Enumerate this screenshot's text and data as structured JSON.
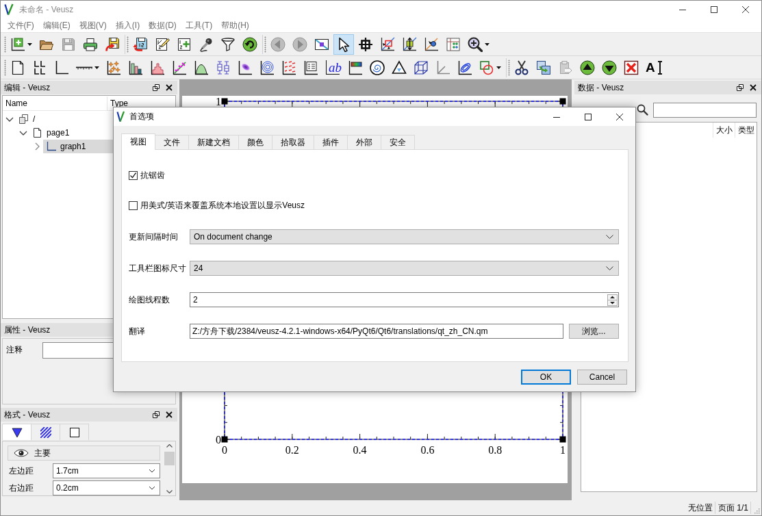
{
  "window": {
    "title": "未命名 - Veusz"
  },
  "menu": [
    "文件(F)",
    "编辑(E)",
    "视图(V)",
    "插入(I)",
    "数据(D)",
    "工具(T)",
    "帮助(H)"
  ],
  "toolbars": [
    [
      [
        {
          "disabled": false,
          "selected": false
        },
        {
          "disabled": false,
          "selected": false
        },
        {
          "disabled": true,
          "selected": false
        },
        {
          "disabled": false,
          "selected": false
        },
        {
          "disabled": false,
          "selected": false
        }
      ],
      [
        {
          "disabled": false,
          "selected": false
        },
        {
          "disabled": false,
          "selected": false
        },
        {
          "disabled": false,
          "selected": false
        },
        {
          "disabled": false,
          "selected": false
        },
        {
          "disabled": false,
          "selected": false
        },
        {
          "disabled": false,
          "selected": false
        }
      ],
      [
        {
          "disabled": true,
          "selected": false
        },
        {
          "disabled": true,
          "selected": false
        },
        {
          "disabled": false,
          "selected": false
        },
        {
          "disabled": false,
          "selected": true
        },
        {
          "disabled": false,
          "selected": false
        },
        {
          "disabled": false,
          "selected": false
        },
        {
          "disabled": false,
          "selected": false
        },
        {
          "disabled": false,
          "selected": false
        },
        {
          "disabled": false,
          "selected": false
        },
        {
          "disabled": false,
          "selected": false
        }
      ]
    ],
    [
      [
        {
          "disabled": false,
          "selected": false
        },
        {
          "disabled": false,
          "selected": false
        },
        {
          "disabled": false,
          "selected": false
        },
        {
          "disabled": false,
          "selected": false
        },
        {
          "disabled": false,
          "selected": false
        },
        {
          "disabled": false,
          "selected": false
        },
        {
          "disabled": false,
          "selected": false
        },
        {
          "disabled": false,
          "selected": false
        },
        {
          "disabled": false,
          "selected": false
        },
        {
          "disabled": false,
          "selected": false
        },
        {
          "disabled": false,
          "selected": false
        },
        {
          "disabled": false,
          "selected": false
        },
        {
          "disabled": false,
          "selected": false
        },
        {
          "disabled": false,
          "selected": false
        },
        {
          "disabled": false,
          "selected": false,
          "text": "ab"
        },
        {
          "disabled": false,
          "selected": false
        },
        {
          "disabled": false,
          "selected": false
        },
        {
          "disabled": false,
          "selected": false
        },
        {
          "disabled": false,
          "selected": false
        },
        {
          "disabled": false,
          "selected": false
        },
        {
          "disabled": false,
          "selected": false
        },
        {
          "disabled": false,
          "selected": false
        }
      ],
      [
        {
          "disabled": false,
          "selected": false
        },
        {
          "disabled": false,
          "selected": false
        },
        {
          "disabled": true,
          "selected": false
        },
        {
          "disabled": false,
          "selected": false
        },
        {
          "disabled": false,
          "selected": false
        },
        {
          "disabled": false,
          "selected": false
        },
        {
          "disabled": false,
          "selected": false,
          "text": "A"
        }
      ]
    ]
  ],
  "edit_panel": {
    "title": "编辑 - Veusz",
    "columns": [
      "Name",
      "Type"
    ],
    "tree": [
      {
        "kind": "document",
        "name": "/",
        "expanded": true,
        "selected": false,
        "children": [
          {
            "kind": "page",
            "name": "page1",
            "expanded": true,
            "selected": false,
            "children": [
              {
                "kind": "graph",
                "name": "graph1",
                "expanded": false,
                "selected": true
              }
            ]
          }
        ]
      }
    ]
  },
  "properties_panel": {
    "title": "属性 - Veusz",
    "fields": [
      {
        "label": "注释"
      }
    ]
  },
  "format_panel": {
    "title": "格式 - Veusz",
    "tabs": [
      {
        "selected": true
      },
      {
        "selected": false
      },
      {
        "selected": false
      }
    ],
    "section": "主要",
    "rows": [
      {
        "label": "左边距",
        "value": "1.7cm"
      },
      {
        "label": "右边距",
        "value": "0.2cm"
      }
    ]
  },
  "page": {
    "graph": {
      "selected": true,
      "chart_data": {
        "type": "line",
        "xlim": [
          0,
          1
        ],
        "ylim": [
          0,
          1
        ],
        "xticks": [
          0,
          0.2,
          0.4,
          0.6,
          0.8,
          1
        ],
        "yticks": [
          0,
          1
        ]
      }
    }
  },
  "data_panel": {
    "title": "数据 - Veusz",
    "columns": [
      "大小",
      "类型"
    ]
  },
  "status_bar": [
    "无位置",
    "页面 1/1"
  ],
  "dialog": {
    "title": "首选项",
    "tabs": [
      {
        "label": "视图",
        "selected": true
      },
      {
        "label": "文件",
        "selected": false
      },
      {
        "label": "新建文档",
        "selected": false
      },
      {
        "label": "颜色",
        "selected": false
      },
      {
        "label": "拾取器",
        "selected": false
      },
      {
        "label": "插件",
        "selected": false
      },
      {
        "label": "外部",
        "selected": false
      },
      {
        "label": "安全",
        "selected": false
      }
    ],
    "checkboxes": [
      {
        "label": "抗锯齿",
        "checked": true
      },
      {
        "label": "用美式/英语来覆盖系统本地设置以显示Veusz",
        "checked": false
      }
    ],
    "fields": [
      {
        "kind": "combo",
        "label": "更新间隔时间",
        "value": "On document change"
      },
      {
        "kind": "combo",
        "label": "工具栏图标尺寸",
        "value": "24"
      },
      {
        "kind": "spin",
        "label": "绘图线程数",
        "value": "2"
      },
      {
        "kind": "file",
        "label": "翻译",
        "value": "Z:/方舟下载/2384/veusz-4.2.1-windows-x64/PyQt6/Qt6/translations/qt_zh_CN.qm",
        "button": "浏览..."
      }
    ],
    "buttons": [
      {
        "label": "OK",
        "default": true
      },
      {
        "label": "Cancel",
        "default": false
      }
    ]
  }
}
